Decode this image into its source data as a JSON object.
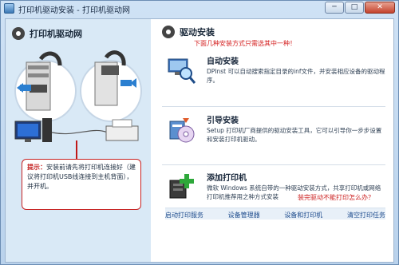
{
  "window": {
    "title": "打印机驱动安装 - 打印机驱动网",
    "buttons": [
      "─",
      "□",
      "✕"
    ]
  },
  "left": {
    "title": "打印机驱动网",
    "tip_label": "提示：",
    "tip_text": "安装前请先将打印机连接好（建议将打印机USB线连接到主机背面），并开机。"
  },
  "right": {
    "title": "驱动安装",
    "subtitle": "下面几种安装方式只需选其中一种！",
    "options": [
      {
        "title": "自动安装",
        "desc": "DPInst 可以自动搜索指定目录的inf文件，并安装相应设备的驱动程序。"
      },
      {
        "title": "引导安装",
        "desc": "Setup 打印机厂商提供的驱动安装工具，它可以引导你一步步设置和安装打印机驱动。"
      },
      {
        "title": "添加打印机",
        "desc": "微软 Windows 系统自带的一种驱动安装方式，共享打印机或网络打印机推荐用之种方式安装"
      }
    ],
    "faq": "装完驱动不能打印怎么办？",
    "links": [
      "启动打印服务",
      "设备管理器",
      "设备和打印机",
      "清空打印任务"
    ]
  },
  "colors": {
    "accent_red": "#c42222",
    "panel_blue": "#d9e9f6",
    "link_blue": "#224f8f"
  }
}
